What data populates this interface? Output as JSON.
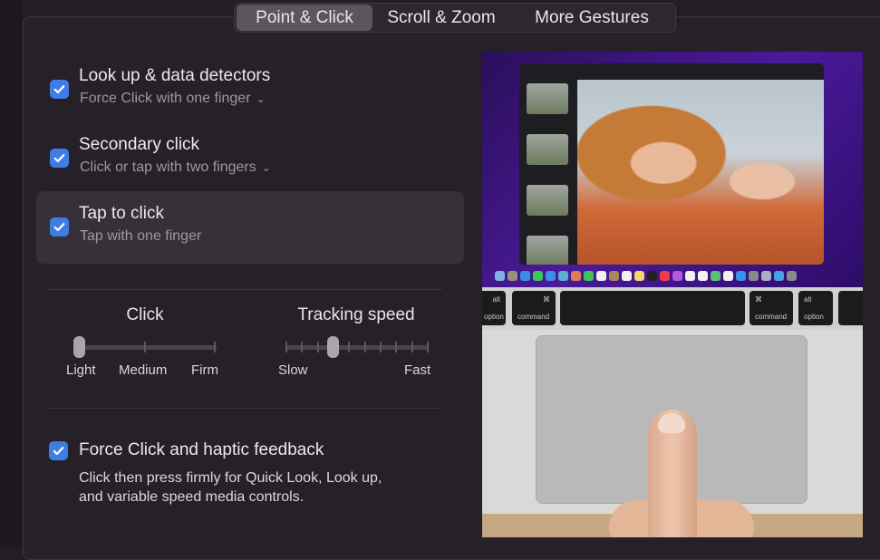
{
  "tabs": [
    {
      "label": "Point & Click",
      "active": true
    },
    {
      "label": "Scroll & Zoom",
      "active": false
    },
    {
      "label": "More Gestures",
      "active": false
    }
  ],
  "options": [
    {
      "title": "Look up & data detectors",
      "subtitle": "Force Click with one finger",
      "has_dropdown": true,
      "checked": true
    },
    {
      "title": "Secondary click",
      "subtitle": "Click or tap with two fingers",
      "has_dropdown": true,
      "checked": true
    },
    {
      "title": "Tap to click",
      "subtitle": "Tap with one finger",
      "has_dropdown": false,
      "checked": true,
      "highlighted": true
    }
  ],
  "click_slider": {
    "label": "Click",
    "stops": [
      "Light",
      "Medium",
      "Firm"
    ],
    "value": "Light"
  },
  "tracking_slider": {
    "label": "Tracking speed",
    "min_label": "Slow",
    "max_label": "Fast",
    "ticks": 10,
    "value_fraction": 0.33
  },
  "force_click": {
    "title": "Force Click and haptic feedback",
    "description_line1": "Click then press firmly for Quick Look, Look up,",
    "description_line2": "and variable speed media controls.",
    "checked": true
  },
  "preview": {
    "keys": [
      {
        "top": "alt",
        "bottom": "option"
      },
      {
        "top": "⌘",
        "bottom": "command"
      },
      {
        "top": "⌘",
        "bottom": "command"
      },
      {
        "top": "alt",
        "bottom": "option"
      }
    ],
    "dock_colors": [
      "#7fb0e8",
      "#9a8f80",
      "#3a8de0",
      "#3fc45a",
      "#3d8ee8",
      "#5ab0d0",
      "#e07a5a",
      "#3fc45a",
      "#f0f0f0",
      "#a8885a",
      "#f0f0f0",
      "#f5d66a",
      "#222222",
      "#f03a4a",
      "#b05ae0",
      "#f0f0f0",
      "#f0f0f0",
      "#5ac07a",
      "#f0f0f0",
      "#3a8ef0",
      "#8a8a8a",
      "#aab0c0",
      "#4aa0e0",
      "#8a8a90"
    ]
  },
  "accent": "#3f7de6"
}
